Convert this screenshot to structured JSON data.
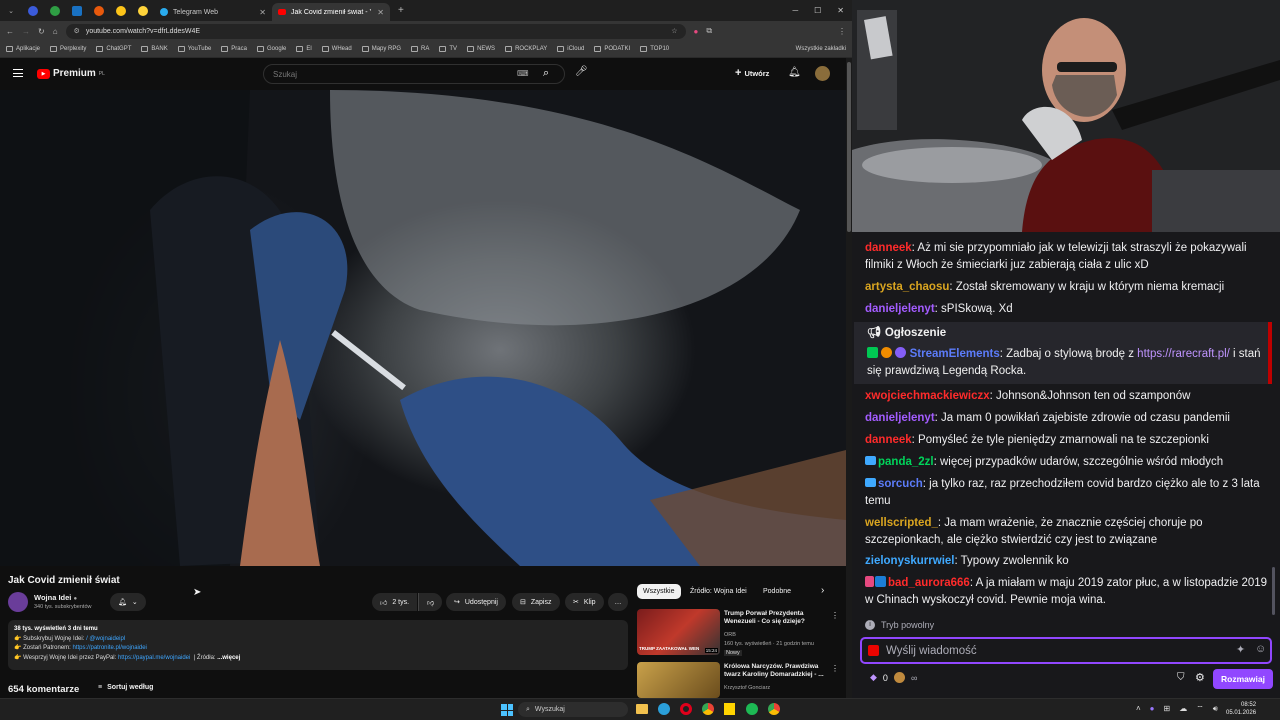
{
  "browser": {
    "tabs": [
      {
        "label": "Telegram Web"
      },
      {
        "label": "Jak Covid zmienił świat - Yo"
      }
    ],
    "url": "youtube.com/watch?v=dfrLddesW4E",
    "bookmarks": [
      "Aplikacje",
      "Perplexity",
      "ChatGPT",
      "BANK",
      "YouTube",
      "Praca",
      "Google",
      "El",
      "WHead",
      "Mapy RPG",
      "RA",
      "TV",
      "NEWS",
      "ROCKPLAY",
      "iCloud",
      "PODATKI",
      "TOP10"
    ],
    "bookmarks_all": "Wszystkie zakładki"
  },
  "youtube": {
    "logo": "Premium",
    "logo_sup": "PL",
    "search_placeholder": "Szukaj",
    "create_label": "Utwórz",
    "video": {
      "title": "Jak Covid zmienił świat",
      "channel": "Wojna Idei",
      "subscribers": "340 tys. subskrybentów",
      "likes": "2 tys.",
      "share": "Udostępnij",
      "save": "Zapisz",
      "clip": "Klip",
      "views": "38 tys. wyświetleń  3 dni temu",
      "desc_line1": "👉 Subskrybuj Wojnę Idei: ",
      "desc_line1_link": "/ @wojnaideipl",
      "desc_line2": "👉 Zostań Patronem: ",
      "desc_line2_link": "https://patronite.pl/wojnaidei",
      "desc_line3": "👉 Wesprzyj Wojnę Idei przez PayPal: ",
      "desc_line3_link": "https://paypal.me/wojnaidei",
      "desc_sources": "|   Źródła: ",
      "desc_more": "...więcej",
      "comments": "654 komentarze",
      "sort": "Sortuj według"
    },
    "chips": [
      "Wszystkie",
      "Źródło: Wojna Idei",
      "Podobne"
    ],
    "related": [
      {
        "title": "Trump Porwał Prezydenta Wenezueli - Co się dzieje?",
        "channel": "ORB",
        "meta": "160 tys. wyświetleń · 21 godzin temu",
        "badge": "Nowy",
        "thumb_text": "TRUMP ZAATAKOWAŁ WEN",
        "duration": "15:24"
      },
      {
        "title": "Królowa Narcyzów. Prawdziwa twarz Karoliny Domaradzkiej - ...",
        "channel": "Krzysztof Gonciarz",
        "meta": "",
        "badge": "",
        "thumb_text": "",
        "duration": ""
      }
    ]
  },
  "chat": {
    "messages": [
      {
        "user": "danneek",
        "color": "#ff2b2b",
        "text": ": Aż mi sie przypomniało jak w telewizji tak straszyli że pokazywali filmiki z Włoch że śmieciarki juz zabierają ciała z ulic xD"
      },
      {
        "user": "artysta_chaosu",
        "color": "#daa520",
        "text": ": Został skremowany w kraju w którym niema kremacji"
      },
      {
        "user": "danieljelenyt",
        "color": "#a35cff",
        "text": ": sPISkową. Xd"
      },
      {
        "user": "xwojciechmackiewiczx",
        "color": "#ff2b2b",
        "text": ": Johnson&Johnson ten od szamponów"
      },
      {
        "user": "danieljelenyt",
        "color": "#a35cff",
        "text": ": Ja mam 0 powikłań zajebiste zdrowie od czasu pandemii"
      },
      {
        "user": "danneek",
        "color": "#ff2b2b",
        "text": ": Pomyśleć że tyle pieniędzy zmarnowali na te szczepionki"
      },
      {
        "user": "panda_2zl",
        "color": "#00d45a",
        "text": ": więcej przypadków udarów, szczególnie wśród młodych"
      },
      {
        "user": "sorcuch",
        "color": "#5c7cfa",
        "text": ": ja tylko raz, raz przechodziłem covid bardzo ciężko ale to z 3 lata temu"
      },
      {
        "user": "wellscripted_",
        "color": "#daa520",
        "text": ": Ja mam wrażenie, że znacznie częściej choruje po szczepionkach, ale ciężko stwierdzić czy jest to związane"
      },
      {
        "user": "zielonyskurrwiel",
        "color": "#3fa9ff",
        "text": ": Typowy zwolennik ko"
      },
      {
        "user": "bad_aurora666",
        "color": "#ff2b2b",
        "text": ": A ja miałam w maju 2019 zator płuc, a w listopadzie 2019 w Chinach wyskoczył covid. Pewnie moja wina."
      }
    ],
    "announcement_label": "Ogłoszenie",
    "announcement_user": "StreamElements",
    "announcement_text": ": Zadbaj o stylową brodę z ",
    "announcement_link": "https://rarecraft.pl/",
    "announcement_tail": " i stań się prawdziwą Legendą Rocka.",
    "slow_mode": "Tryb powolny",
    "input_placeholder": "Wyślij wiadomość",
    "points": "0",
    "send_label": "Rozmawiaj"
  },
  "taskbar": {
    "search_label": "Wyszukaj",
    "time": "08:52",
    "date": "05.01.2026"
  }
}
